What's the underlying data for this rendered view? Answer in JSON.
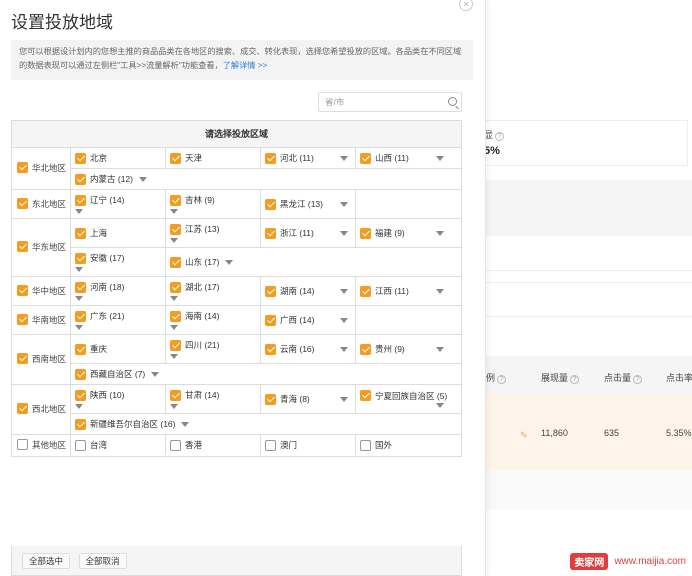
{
  "modal": {
    "title": "设置投放地域",
    "close_glyph": "×",
    "note_text": "您可以根据设计划内的您想主推的商品品类在各地区的搜索、成交、转化表现，选择您希望投放的区域。各品类在不同区域的数据表现可以通过左侧栏\"工具>>流量解析\"功能查看，",
    "note_link": "了解详情 >>",
    "search": {
      "placeholder": "省/市"
    },
    "table_header": "请选择投放区域",
    "regions": [
      {
        "label": "华北地区",
        "rows": [
          [
            {
              "name": "北京",
              "checked": true
            },
            {
              "name": "天津",
              "checked": true
            },
            {
              "name": "河北 (11)",
              "checked": true,
              "dd": true
            },
            {
              "name": "山西 (11)",
              "checked": true,
              "dd": true
            }
          ],
          [
            {
              "name": "内蒙古 (12)",
              "checked": true,
              "dd": true,
              "fill": true
            }
          ]
        ]
      },
      {
        "label": "东北地区",
        "rows": [
          [
            {
              "name": "辽宁 (14)",
              "checked": true,
              "ddUnder": true
            },
            {
              "name": "吉林 (9)",
              "checked": true,
              "ddUnder": true
            },
            {
              "name": "黑龙江 (13)",
              "checked": true,
              "dd": true
            },
            {
              "empty": true
            }
          ]
        ]
      },
      {
        "label": "华东地区",
        "rows": [
          [
            {
              "name": "上海",
              "checked": true
            },
            {
              "name": "江苏 (13)",
              "checked": true,
              "ddUnder": true
            },
            {
              "name": "浙江 (11)",
              "checked": true,
              "dd": true
            },
            {
              "name": "福建 (9)",
              "checked": true,
              "dd": true
            }
          ],
          [
            {
              "name": "安徽 (17)",
              "checked": true,
              "ddUnder": true
            },
            {
              "name": "山东 (17)",
              "checked": true,
              "dd": true,
              "fill": true
            }
          ]
        ]
      },
      {
        "label": "华中地区",
        "rows": [
          [
            {
              "name": "河南 (18)",
              "checked": true,
              "ddUnder": true
            },
            {
              "name": "湖北 (17)",
              "checked": true,
              "ddUnder": true
            },
            {
              "name": "湖南 (14)",
              "checked": true,
              "dd": true
            },
            {
              "name": "江西 (11)",
              "checked": true,
              "dd": true
            }
          ]
        ]
      },
      {
        "label": "华南地区",
        "rows": [
          [
            {
              "name": "广东 (21)",
              "checked": true,
              "ddUnder": true
            },
            {
              "name": "海南 (14)",
              "checked": true,
              "ddUnder": true
            },
            {
              "name": "广西 (14)",
              "checked": true,
              "dd": true
            },
            {
              "empty": true
            }
          ]
        ]
      },
      {
        "label": "西南地区",
        "rows": [
          [
            {
              "name": "重庆",
              "checked": true
            },
            {
              "name": "四川 (21)",
              "checked": true,
              "ddUnder": true
            },
            {
              "name": "云南 (16)",
              "checked": true,
              "dd": true
            },
            {
              "name": "贵州 (9)",
              "checked": true,
              "dd": true
            }
          ],
          [
            {
              "name": "西藏自治区 (7)",
              "checked": true,
              "dd": true,
              "fill": true
            }
          ]
        ]
      },
      {
        "label": "西北地区",
        "rows": [
          [
            {
              "name": "陕西 (10)",
              "checked": true,
              "ddUnder": true
            },
            {
              "name": "甘肃 (14)",
              "checked": true,
              "ddUnder": true
            },
            {
              "name": "青海 (8)",
              "checked": true,
              "dd": true
            },
            {
              "name": "宁夏回族自治区 (5)",
              "checked": true,
              "dd": true
            }
          ],
          [
            {
              "name": "新疆维吾尔自治区 (16)",
              "checked": true,
              "dd": true,
              "fill": true
            }
          ]
        ]
      },
      {
        "label": "其他地区",
        "checked": false,
        "rows": [
          [
            {
              "name": "台湾",
              "checked": false
            },
            {
              "name": "香港",
              "checked": false
            },
            {
              "name": "澳门",
              "checked": false
            },
            {
              "name": "国外",
              "checked": false
            }
          ]
        ]
      }
    ],
    "buttons": {
      "select_all": "全部选中",
      "clear_all": "全部取消"
    }
  },
  "background": {
    "frag_pct": "5%",
    "frag_label": "显",
    "col_ratio": "例",
    "col_impressions": "展现量",
    "col_clicks": "点击量",
    "col_ctr": "点击率",
    "impressions": "11,860",
    "clicks": "635",
    "ctr": "5.35%"
  },
  "watermark": {
    "logo": "卖家网",
    "url": "www.maijia.com"
  },
  "colors": {
    "checkbox": "#f39c1f",
    "link": "#2f7cd7",
    "watermark": "#e23d3d"
  }
}
